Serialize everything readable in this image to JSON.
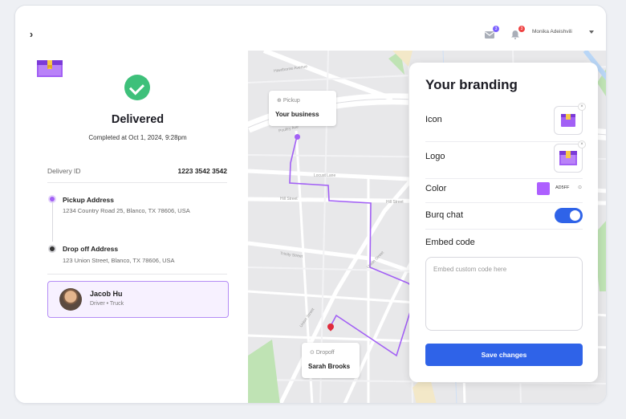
{
  "topbar": {
    "user_name": "Monika Adeishvili",
    "mail_badge": "3",
    "notif_badge": "3"
  },
  "delivery": {
    "status": "Delivered",
    "completed": "Completed at Oct 1, 2024, 9:28pm",
    "id_label": "Delivery ID",
    "id_value": "1223 3542 3542",
    "pickup_title": "Pickup Address",
    "pickup_address": "1234 Country Road 25, Blanco, TX 78606, USA",
    "dropoff_title": "Drop off Address",
    "dropoff_address": "123 Union Street, Blanco, TX 78606, USA",
    "driver_name": "Jacob Hu",
    "driver_sub": "Driver  •  Truck"
  },
  "map": {
    "streets": [
      "Hawthorne Avenue",
      "Poultry Ave",
      "Locust Lane",
      "Hill Street",
      "Hill Street",
      "Trinity Street",
      "Union Street",
      "Union Street"
    ],
    "pickup_tag": "Pickup",
    "pickup_name": "Your business",
    "dropoff_tag": "Dropoff",
    "dropoff_name": "Sarah Brooks"
  },
  "branding": {
    "title": "Your branding",
    "icon_label": "Icon",
    "logo_label": "Logo",
    "color_label": "Color",
    "color_hex": "AD5FF",
    "color_value": "#ad5fff",
    "burq_label": "Burq chat",
    "burq_enabled": true,
    "embed_label": "Embed code",
    "embed_placeholder": "Embed custom code here",
    "save_label": "Save changes"
  }
}
